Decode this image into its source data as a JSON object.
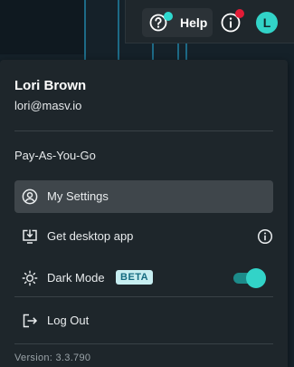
{
  "topbar": {
    "help_label": "Help",
    "avatar_initial": "L",
    "help_badge_color": "#2ed9cf",
    "info_badge_color": "#e21b36"
  },
  "menu": {
    "user_name": "Lori Brown",
    "user_email": "lori@masv.io",
    "plan": "Pay-As-You-Go",
    "items": [
      {
        "label": "My Settings",
        "icon": "user-circle-icon",
        "active": true
      },
      {
        "label": "Get desktop app",
        "icon": "download-desktop-icon",
        "right_icon": "info-icon"
      },
      {
        "label": "Dark Mode",
        "icon": "sun-icon",
        "badge": "BETA",
        "toggle_on": true
      },
      {
        "label": "Log Out",
        "icon": "logout-icon"
      }
    ],
    "version": "Version: 3.3.790"
  }
}
